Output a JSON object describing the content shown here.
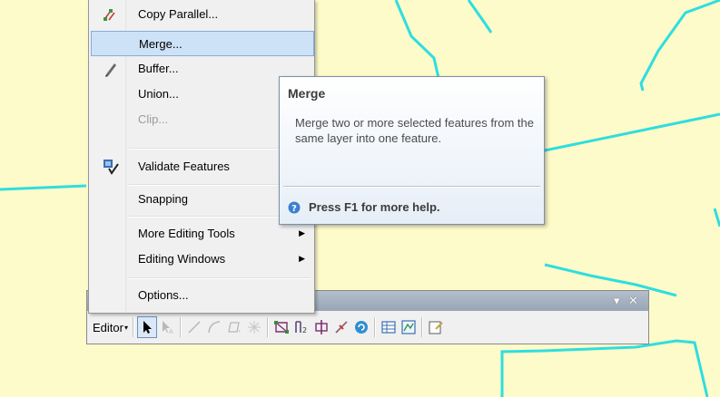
{
  "map": {
    "background_color": "#fdfbc9",
    "line_color": "#2fdde0"
  },
  "context_menu": {
    "items": [
      {
        "label": "Copy Parallel...",
        "icon": "copy-parallel-icon",
        "state": "normal"
      },
      {
        "label": "Merge...",
        "icon": "",
        "state": "highlighted"
      },
      {
        "label": "Buffer...",
        "icon": "buffer-pencil-icon",
        "state": "normal"
      },
      {
        "label": "Union...",
        "icon": "",
        "state": "normal"
      },
      {
        "label": "Clip...",
        "icon": "",
        "state": "disabled"
      },
      {
        "label": "Validate Features",
        "icon": "validate-features-icon",
        "state": "normal"
      },
      {
        "label": "Snapping",
        "icon": "",
        "state": "normal"
      },
      {
        "label": "More Editing Tools",
        "icon": "",
        "state": "submenu"
      },
      {
        "label": "Editing Windows",
        "icon": "",
        "state": "submenu"
      },
      {
        "label": "Options...",
        "icon": "",
        "state": "normal"
      }
    ]
  },
  "tooltip": {
    "title": "Merge",
    "body": "Merge two or more selected features from the same layer into one feature.",
    "help": "Press F1 for more help."
  },
  "toolbar": {
    "editor_label": "Editor",
    "dropdown_arrow": "▾",
    "pin_icon": "▾",
    "close_icon": "✕",
    "tools": [
      "edit-tool-icon",
      "edit-annotation-icon",
      "straight-segment-icon",
      "end-point-arc-icon",
      "construction-tools-icon",
      "midpoint-icon",
      "edit-vertices-icon",
      "reshape-feature-icon",
      "cut-polygons-icon",
      "split-tool-icon",
      "rotate-tool-icon",
      "attributes-icon",
      "sketch-properties-icon",
      "create-features-icon"
    ]
  }
}
